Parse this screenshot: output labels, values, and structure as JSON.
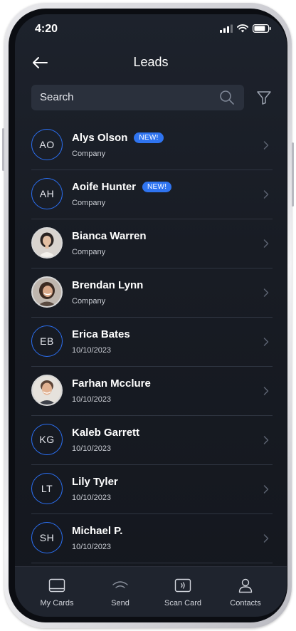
{
  "status_bar": {
    "time": "4:20"
  },
  "header": {
    "title": "Leads"
  },
  "search": {
    "placeholder": "Search"
  },
  "leads": [
    {
      "initials": "AO",
      "name": "Alys Olson",
      "subtitle": "Company",
      "badge": "NEW!"
    },
    {
      "initials": "AH",
      "name": "Aoife Hunter",
      "subtitle": "Company",
      "badge": "NEW!"
    },
    {
      "name": "Bianca Warren",
      "subtitle": "Company"
    },
    {
      "name": "Brendan Lynn",
      "subtitle": "Company"
    },
    {
      "initials": "EB",
      "name": "Erica Bates",
      "subtitle": "10/10/2023"
    },
    {
      "name": "Farhan Mcclure",
      "subtitle": "10/10/2023"
    },
    {
      "initials": "KG",
      "name": "Kaleb Garrett",
      "subtitle": "10/10/2023"
    },
    {
      "initials": "LT",
      "name": "Lily Tyler",
      "subtitle": "10/10/2023"
    },
    {
      "initials": "SH",
      "name": "Michael P.",
      "subtitle": "10/10/2023"
    }
  ],
  "tabs": [
    {
      "label": "My Cards",
      "icon": "card-icon"
    },
    {
      "label": "Send",
      "icon": "send-wave-icon"
    },
    {
      "label": "Scan Card",
      "icon": "scan-card-icon"
    },
    {
      "label": "Contacts",
      "icon": "contacts-icon"
    }
  ],
  "colors": {
    "background": "#181c24",
    "accent": "#2f74f0",
    "search_bg": "#2a303c",
    "tab_bar_bg": "#1f242e"
  }
}
